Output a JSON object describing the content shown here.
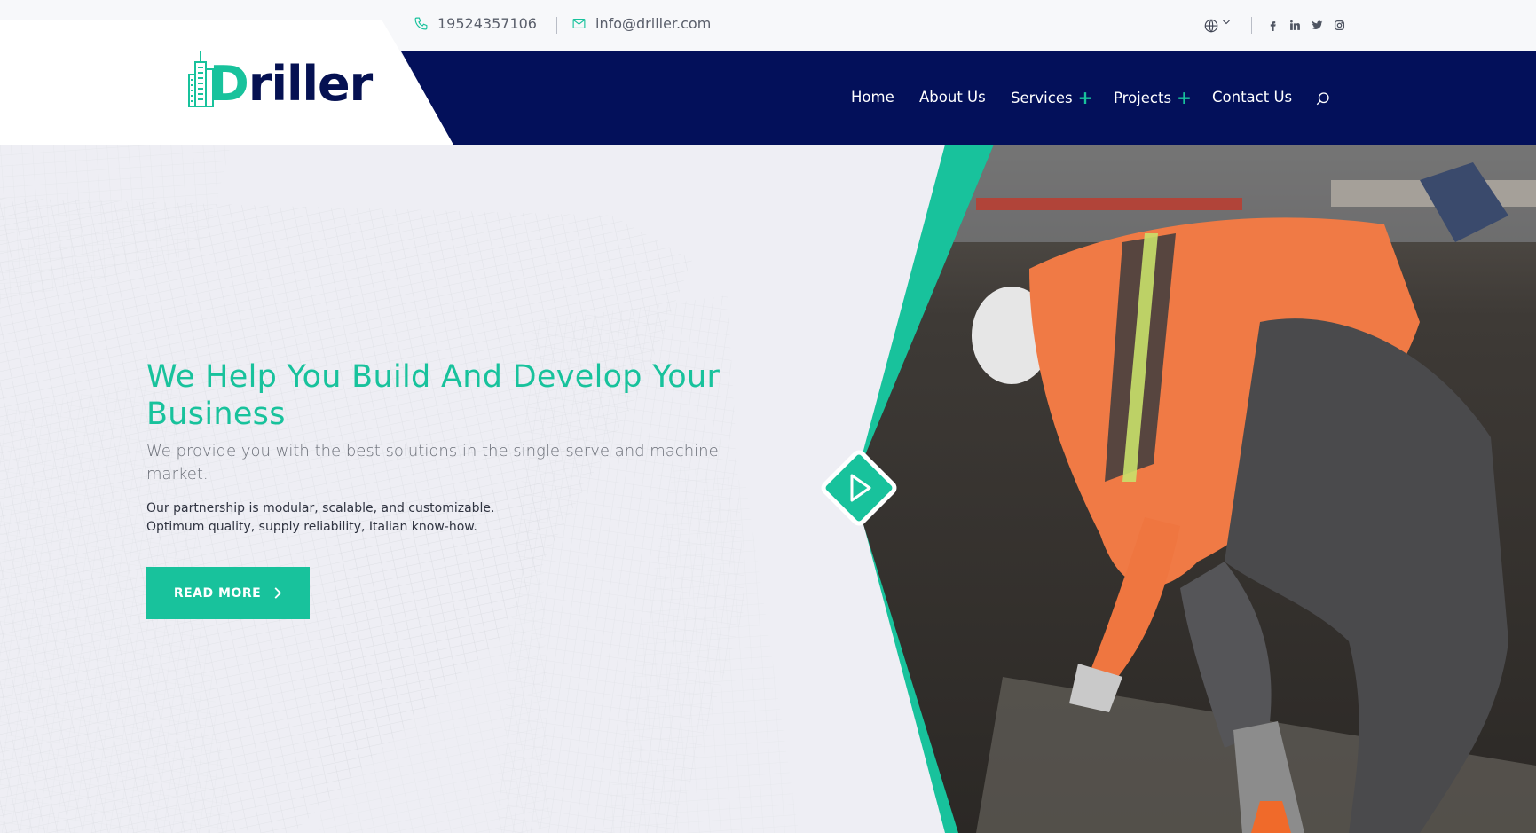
{
  "topbar": {
    "phone": "19524357106",
    "email": "info@driller.com",
    "language_icon": "globe-icon",
    "social_icons": [
      "facebook-icon",
      "linkedin-icon",
      "twitter-icon",
      "instagram-icon"
    ]
  },
  "logo": {
    "text_first": "D",
    "text_rest": "riller"
  },
  "nav": {
    "items": [
      {
        "label": "Home"
      },
      {
        "label": "About Us"
      },
      {
        "label": "Services",
        "expandable": true
      },
      {
        "label": "Projects",
        "expandable": true
      },
      {
        "label": "Contact Us"
      }
    ],
    "search_icon": "search-icon"
  },
  "hero": {
    "title": "We Help You Build And Develop Your Business",
    "subtitle": "We provide you with the best solutions in the single-serve and machine market.",
    "line1": "Our partnership is modular, scalable, and customizable.",
    "line2": "Optimum quality, supply reliability, Italian know-how.",
    "button_label": "READ MORE",
    "play_icon": "play-icon"
  },
  "colors": {
    "accent": "#18c29c",
    "navy": "#03105a",
    "topbar_bg": "#f7f8fa",
    "hero_bg": "#eeeff4"
  }
}
